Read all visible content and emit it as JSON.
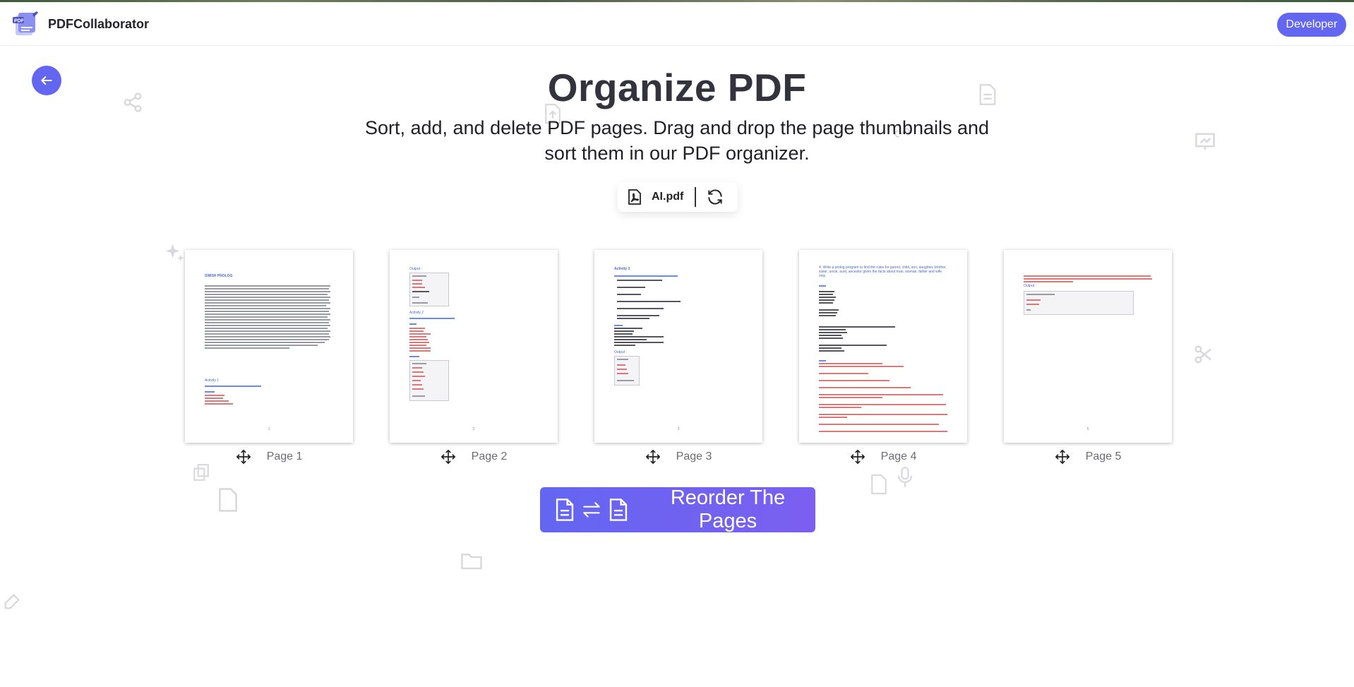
{
  "header": {
    "brand": "PDFCollaborator",
    "developer_label": "Developer"
  },
  "main": {
    "title": "Organize PDF",
    "subtitle": "Sort, add, and delete PDF pages. Drag and drop the page thumbnails and sort them in our PDF organizer.",
    "file": {
      "name": "AI.pdf"
    },
    "pages": [
      {
        "label": "Page 1",
        "heading": "SWISH PROLOG",
        "activity": "Activity 1"
      },
      {
        "label": "Page 2",
        "heading": "Output :",
        "activity": "Activity 2"
      },
      {
        "label": "Page 3",
        "heading": "Activity 3",
        "activity": "Output :"
      },
      {
        "label": "Page 4",
        "heading": "4. Write a prolog program to find the rules for parent, child, son, daughter, brother, sister, uncle, aunt, ancestor given the facts about man, woman, father and wife only.",
        "activity": ""
      },
      {
        "label": "Page 5",
        "heading": "Output :",
        "activity": ""
      }
    ],
    "reorder_label": "Reorder The Pages"
  },
  "colors": {
    "accent": "#6366f1",
    "accent_end": "#7c5ff0",
    "bg_icons": "#d9d9dd"
  }
}
